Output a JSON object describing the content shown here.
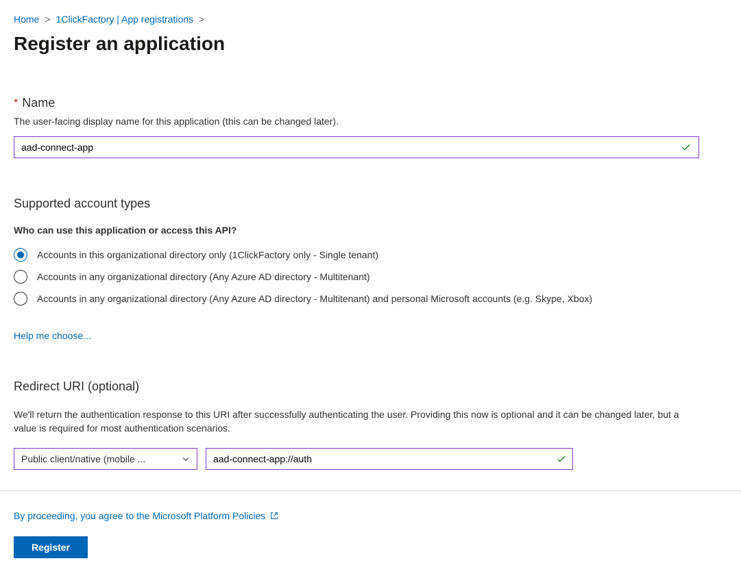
{
  "breadcrumb": {
    "home": "Home",
    "parent": "1ClickFactory | App registrations"
  },
  "page": {
    "title": "Register an application"
  },
  "name_section": {
    "label": "Name",
    "help": "The user-facing display name for this application (this can be changed later).",
    "value": "aad-connect-app"
  },
  "accounts_section": {
    "heading": "Supported account types",
    "question": "Who can use this application or access this API?",
    "options": [
      {
        "label": "Accounts in this organizational directory only (1ClickFactory only - Single tenant)",
        "selected": true
      },
      {
        "label": "Accounts in any organizational directory (Any Azure AD directory - Multitenant)",
        "selected": false
      },
      {
        "label": "Accounts in any organizational directory (Any Azure AD directory - Multitenant) and personal Microsoft accounts (e.g. Skype, Xbox)",
        "selected": false
      }
    ],
    "help_link": "Help me choose..."
  },
  "redirect_section": {
    "heading": "Redirect URI (optional)",
    "description": "We'll return the authentication response to this URI after successfully authenticating the user. Providing this now is optional and it can be changed later, but a value is required for most authentication scenarios.",
    "platform_selected": "Public client/native (mobile ...",
    "uri_value": "aad-connect-app://auth"
  },
  "footer": {
    "policies_text": "By proceeding, you agree to the Microsoft Platform Policies",
    "register_label": "Register"
  }
}
